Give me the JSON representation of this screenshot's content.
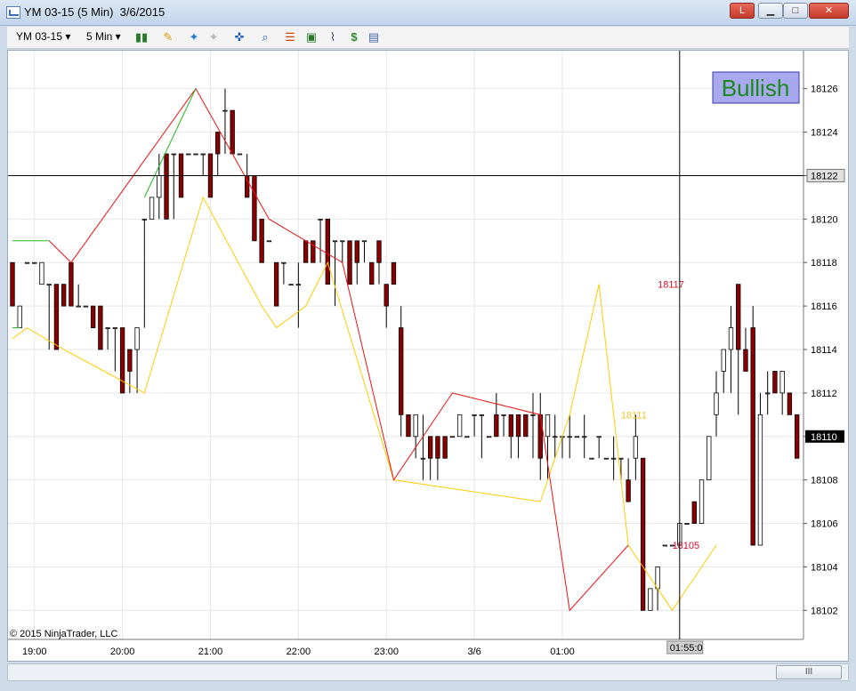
{
  "window": {
    "title": "YM 03-15 (5 Min)  3/6/2015",
    "buttons": {
      "alert": "L",
      "minimize": "▁",
      "maximize": "□",
      "close": "✕"
    }
  },
  "toolbar": {
    "instrument": "YM 03-15",
    "interval": "5 Min",
    "icons": [
      "candlestick-icon",
      "pencil-icon",
      "draw-tool-icon",
      "draw-tool-disabled-icon",
      "crosshair-icon",
      "zoom-icon",
      "properties-icon",
      "strategy-icon",
      "indicator-icon",
      "dollar-icon",
      "template-icon"
    ]
  },
  "chart": {
    "signal_label": "Bullish",
    "copyright": "© 2015 NinjaTrader, LLC",
    "scrollbar_grip": "III",
    "price_axis": [
      "18126",
      "18124",
      "18122",
      "18120",
      "18118",
      "18116",
      "18114",
      "18112",
      "18110",
      "18108",
      "18106",
      "18104",
      "18102"
    ],
    "current_price": "18110",
    "crosshair_price": "18122",
    "crosshair_time": "01:55:0",
    "time_axis": [
      "19:00",
      "20:00",
      "21:00",
      "22:00",
      "23:00",
      "3/6",
      "01:00"
    ],
    "annotations": [
      {
        "text": "18117",
        "color": "#d0102a"
      },
      {
        "text": "18111",
        "color": "#f2c22a"
      },
      {
        "text": "18105",
        "color": "#d0102a"
      }
    ],
    "colors": {
      "up": "#ffffff",
      "down": "#8b0000",
      "green_line": "#22bb22",
      "red_line": "#ee1111",
      "yellow_line": "#ffcc00",
      "signal_bg": "#a8a8ee",
      "signal_text": "#1a8a1a"
    }
  },
  "chart_data": {
    "type": "candlestick",
    "ylim": [
      18100.5,
      18127.5
    ],
    "x_ticks": [
      "19:00",
      "20:00",
      "21:00",
      "22:00",
      "23:00",
      "3/6",
      "01:00"
    ],
    "candles": [
      [
        18118,
        18118,
        18116,
        18116
      ],
      [
        18115,
        18116,
        18115,
        18116
      ],
      [
        18118,
        18118,
        18118,
        18118
      ],
      [
        18118,
        18118,
        18118,
        18118
      ],
      [
        18117,
        18118,
        18117,
        18118
      ],
      [
        18117,
        18117,
        18114,
        18117
      ],
      [
        18117,
        18117,
        18114,
        18114
      ],
      [
        18117,
        18117,
        18116,
        18116
      ],
      [
        18118,
        18118,
        18116,
        18116
      ],
      [
        18116,
        18117,
        18116,
        18116
      ],
      [
        18116,
        18116,
        18116,
        18116
      ],
      [
        18116,
        18116,
        18115,
        18115
      ],
      [
        18116,
        18116,
        18114,
        18114
      ],
      [
        18115,
        18115,
        18114,
        18115
      ],
      [
        18115,
        18115,
        18113,
        18115
      ],
      [
        18115,
        18115,
        18112,
        18112
      ],
      [
        18114,
        18114,
        18112,
        18113
      ],
      [
        18114,
        18115,
        18112,
        18115
      ],
      [
        18120,
        18120,
        18115,
        18120
      ],
      [
        18120,
        18121,
        18120,
        18121
      ],
      [
        18121,
        18123,
        18120,
        18122
      ],
      [
        18123,
        18123,
        18120,
        18120
      ],
      [
        18123,
        18123,
        18120,
        18123
      ],
      [
        18123,
        18123,
        18121,
        18121
      ],
      [
        18123,
        18123,
        18123,
        18123
      ],
      [
        18123,
        18123,
        18123,
        18123
      ],
      [
        18123,
        18123,
        18122,
        18123
      ],
      [
        18123,
        18123,
        18121,
        18121
      ],
      [
        18124,
        18124,
        18122,
        18123
      ],
      [
        18125,
        18126,
        18123,
        18125
      ],
      [
        18125,
        18125,
        18123,
        18123
      ],
      [
        18123,
        18123,
        18123,
        18123
      ],
      [
        18122,
        18123,
        18121,
        18121
      ],
      [
        18122,
        18122,
        18119,
        18119
      ],
      [
        18120,
        18120,
        18118,
        18118
      ],
      [
        18119,
        18119,
        18119,
        18119
      ],
      [
        18118,
        18118,
        18116,
        18116
      ],
      [
        18118,
        18118,
        18117,
        18118
      ],
      [
        18117,
        18117,
        18117,
        18117
      ],
      [
        18117,
        18118,
        18115,
        18117
      ],
      [
        18119,
        18119,
        18118,
        18118
      ],
      [
        18119,
        18119,
        18118,
        18118
      ],
      [
        18120,
        18120,
        18118,
        18120
      ],
      [
        18120,
        18120,
        18117,
        18117
      ],
      [
        18119,
        18119,
        18116,
        18119
      ],
      [
        18119,
        18119,
        18118,
        18119
      ],
      [
        18119,
        18119,
        18117,
        18117
      ],
      [
        18119,
        18119,
        18117,
        18118
      ],
      [
        18119,
        18119,
        18118,
        18119
      ],
      [
        18118,
        18118,
        18117,
        18117
      ],
      [
        18119,
        18119,
        18117,
        18118
      ],
      [
        18117,
        18117,
        18115,
        18116
      ],
      [
        18118,
        18118,
        18117,
        18117
      ],
      [
        18115,
        18116,
        18110,
        18111
      ],
      [
        18111,
        18111,
        18110,
        18110
      ],
      [
        18110,
        18111,
        18109,
        18111
      ],
      [
        18109,
        18111,
        18108,
        18109
      ],
      [
        18110,
        18110,
        18108,
        18109
      ],
      [
        18110,
        18110,
        18108,
        18109
      ],
      [
        18110,
        18110,
        18109,
        18109
      ],
      [
        18110,
        18110,
        18110,
        18110
      ],
      [
        18110,
        18111,
        18110,
        18111
      ],
      [
        18110,
        18110,
        18110,
        18110
      ],
      [
        18111,
        18111,
        18110,
        18111
      ],
      [
        18111,
        18111,
        18109,
        18111
      ],
      [
        18110,
        18110,
        18110,
        18110
      ],
      [
        18111,
        18112,
        18110,
        18110
      ],
      [
        18111,
        18111,
        18110,
        18111
      ],
      [
        18111,
        18111,
        18109,
        18110
      ],
      [
        18111,
        18111,
        18109,
        18110
      ],
      [
        18111,
        18111,
        18110,
        18110
      ],
      [
        18111,
        18112,
        18109,
        18111
      ],
      [
        18111,
        18112,
        18108,
        18109
      ],
      [
        18110,
        18111,
        18108,
        18111
      ],
      [
        18110,
        18111,
        18109,
        18110
      ],
      [
        18110,
        18110,
        18109,
        18110
      ],
      [
        18110,
        18111,
        18109,
        18110
      ],
      [
        18110,
        18110,
        18110,
        18110
      ],
      [
        18110,
        18111,
        18109,
        18110
      ],
      [
        18109,
        18109,
        18109,
        18109
      ],
      [
        18110,
        18110,
        18109,
        18110
      ],
      [
        18109,
        18109,
        18109,
        18109
      ],
      [
        18109,
        18110,
        18108,
        18109
      ],
      [
        18109,
        18109,
        18108,
        18109
      ],
      [
        18108,
        18109,
        18107,
        18107
      ],
      [
        18109,
        18111,
        18108,
        18110
      ],
      [
        18109,
        18109,
        18102,
        18102
      ],
      [
        18102,
        18103,
        18102,
        18103
      ],
      [
        18103,
        18104,
        18102,
        18104
      ],
      [
        18105,
        18105,
        18105,
        18105
      ],
      [
        18105,
        18105,
        18105,
        18105
      ],
      [
        18105,
        18106,
        18105,
        18106
      ],
      [
        18106,
        18106,
        18106,
        18106
      ],
      [
        18107,
        18107,
        18106,
        18106
      ],
      [
        18106,
        18108,
        18106,
        18108
      ],
      [
        18108,
        18110,
        18108,
        18110
      ],
      [
        18111,
        18113,
        18110,
        18112
      ],
      [
        18113,
        18114,
        18112,
        18114
      ],
      [
        18114,
        18116,
        18112,
        18115
      ],
      [
        18117,
        18117,
        18111,
        18114
      ],
      [
        18114,
        18115,
        18113,
        18113
      ],
      [
        18115,
        18116,
        18105,
        18105
      ],
      [
        18105,
        18112,
        18105,
        18111
      ],
      [
        18112,
        18113,
        18111,
        18112
      ],
      [
        18113,
        18113,
        18112,
        18112
      ],
      [
        18112,
        18113,
        18111,
        18113
      ],
      [
        18112,
        18112,
        18111,
        18111
      ],
      [
        18111,
        18111,
        18109,
        18109
      ]
    ],
    "zigzag": {
      "green": [
        [
          0,
          18119
        ],
        [
          5,
          18119
        ]
      ],
      "green_upper": [
        [
          0,
          18115
        ],
        [
          1,
          18115
        ]
      ],
      "yellow": [
        [
          0,
          18114.5
        ],
        [
          2,
          18115
        ],
        [
          7,
          18114
        ],
        [
          18,
          18112
        ],
        [
          26,
          18121
        ],
        [
          34,
          18116
        ],
        [
          36,
          18115
        ],
        [
          40,
          18116
        ],
        [
          43,
          18118
        ],
        [
          52,
          18108
        ],
        [
          72,
          18107
        ],
        [
          76,
          18111
        ],
        [
          80,
          18117
        ],
        [
          84,
          18105
        ],
        [
          90,
          18102
        ],
        [
          96,
          18105
        ]
      ],
      "red": [
        [
          5,
          18119
        ],
        [
          8,
          18118
        ],
        [
          25,
          18126
        ],
        [
          35,
          18120
        ],
        [
          45,
          18118
        ],
        [
          52,
          18108
        ],
        [
          60,
          18112
        ],
        [
          72,
          18111
        ],
        [
          76,
          18102
        ],
        [
          84,
          18105
        ]
      ]
    },
    "annotations": [
      {
        "text": "18117",
        "price": 18117
      },
      {
        "text": "18111",
        "price": 18111
      },
      {
        "text": "18105",
        "price": 18105
      }
    ]
  }
}
